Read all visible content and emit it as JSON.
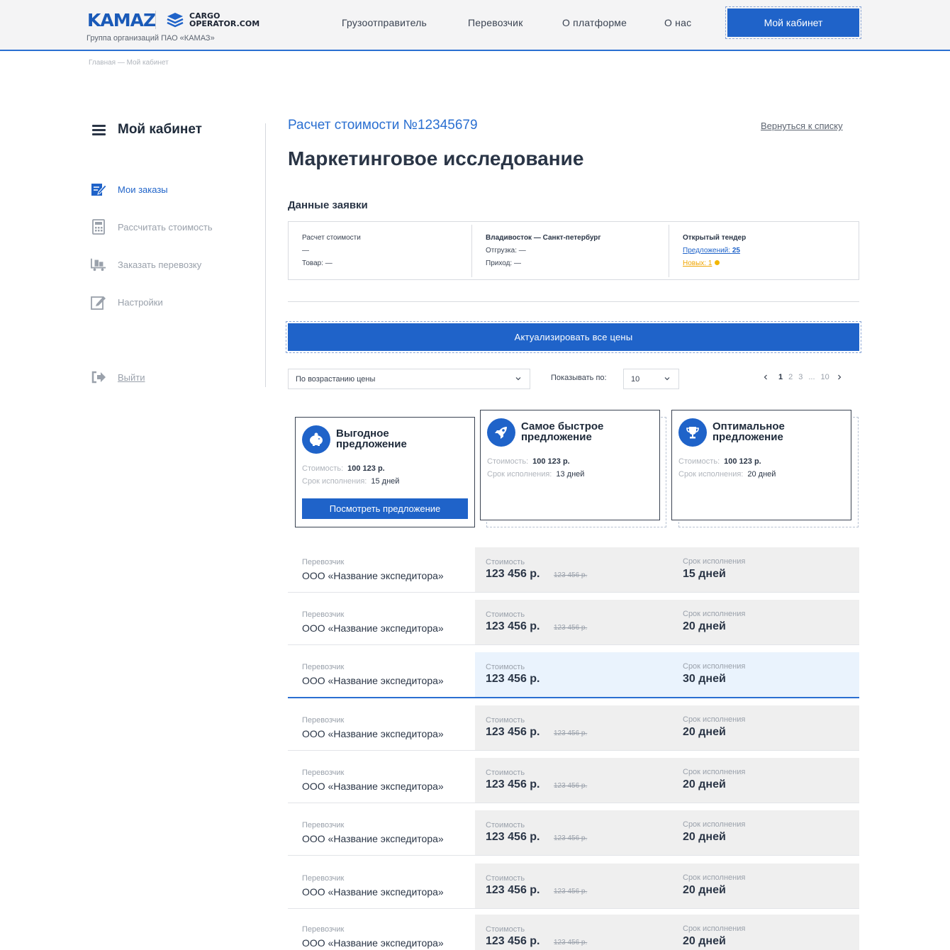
{
  "header": {
    "logo_kamaz": "KAMAZ",
    "logo_cargo_line1": "CARGO",
    "logo_cargo_line2": "OPERATOR.COM",
    "group_text": "Группа организаций ПАО «КАМАЗ»",
    "nav": [
      "Грузоотправитель",
      "Перевозчик",
      "О платформе",
      "О нас"
    ],
    "cabinet_button": "Мой кабинет"
  },
  "breadcrumb": "Главная — Мой кабинет",
  "sidebar": {
    "title": "Мой кабинет",
    "items": [
      {
        "label": "Мои заказы",
        "icon": "orders-icon"
      },
      {
        "label": "Рассчитать стоимость",
        "icon": "calculator-icon"
      },
      {
        "label": "Заказать перевозку",
        "icon": "cargo-icon"
      },
      {
        "label": "Настройки",
        "icon": "settings-edit-icon"
      }
    ],
    "logout": "Выйти"
  },
  "main": {
    "calc_number": "Расчет стоимости №12345679",
    "back_link": "Вернуться к списку",
    "title": "Маркетинговое исследование",
    "section_title": "Данные заявки",
    "request": {
      "col1": {
        "title": "Расчет стоимости",
        "line1": "—",
        "line2": "Товар: —"
      },
      "col2": {
        "title": "Владивосток — Санкт-петербург",
        "line1": "Отгрузка: —",
        "line2": "Приход: —"
      },
      "col3": {
        "title": "Открытый тендер",
        "offers_label": "Предложений:",
        "offers_count": "25",
        "new_label": "Новых:",
        "new_count": "1"
      }
    },
    "actualize_button": "Актуализировать все цены",
    "sort_select": "По возрастанию цены",
    "show_label": "Показывать по:",
    "show_select": "10",
    "pager": {
      "pages": [
        "1",
        "2",
        "3",
        "...",
        "10"
      ],
      "current": "1"
    }
  },
  "offers": [
    {
      "title_line1": "Выгодное",
      "title_line2": "предложение",
      "icon": "piggy-bank-icon",
      "cost_label": "Стоимость:",
      "cost": "100 123 р.",
      "term_label": "Срок исполнения:",
      "term": "15 дней",
      "button": "Посмотреть предложение"
    },
    {
      "title_line1": "Самое быстрое",
      "title_line2": "предложение",
      "icon": "rocket-icon",
      "cost_label": "Стоимость:",
      "cost": "100 123 р.",
      "term_label": "Срок исполнения:",
      "term": "13 дней"
    },
    {
      "title_line1": "Оптимальное",
      "title_line2": "предложение",
      "icon": "trophy-icon",
      "cost_label": "Стоимость:",
      "cost": "100 123 р.",
      "term_label": "Срок исполнения:",
      "term": "20 дней"
    }
  ],
  "carriers_labels": {
    "carrier": "Перевозчик",
    "cost": "Стоимость",
    "term": "Срок исполнения"
  },
  "carriers": [
    {
      "name": "ООО «Название экспедитора»",
      "price": "123 456 р.",
      "old_price": "123 456 р.",
      "days": "15 дней"
    },
    {
      "name": "ООО «Название экспедитора»",
      "price": "123 456 р.",
      "old_price": "123 456 р.",
      "days": "20 дней"
    },
    {
      "name": "ООО «Название экспедитора»",
      "price": "123 456 р.",
      "old_price": "",
      "days": "30 дней"
    },
    {
      "name": "ООО «Название экспедитора»",
      "price": "123 456 р.",
      "old_price": "123 456 р.",
      "days": "20 дней"
    },
    {
      "name": "ООО «Название экспедитора»",
      "price": "123 456 р.",
      "old_price": "123 456 р.",
      "days": "20 дней"
    },
    {
      "name": "ООО «Название экспедитора»",
      "price": "123 456 р.",
      "old_price": "123 456 р.",
      "days": "20 дней"
    },
    {
      "name": "ООО «Название экспедитора»",
      "price": "123 456 р.",
      "old_price": "123 456 р.",
      "days": "20 дней"
    },
    {
      "name": "ООО «Название экспедитора»",
      "price": "123 456 р.",
      "old_price": "123 456 р.",
      "days": "20 дней"
    }
  ],
  "colors": {
    "accent": "#1f63c9",
    "new_dot": "#f2b600",
    "highlight_row": "#eaf3fd"
  }
}
